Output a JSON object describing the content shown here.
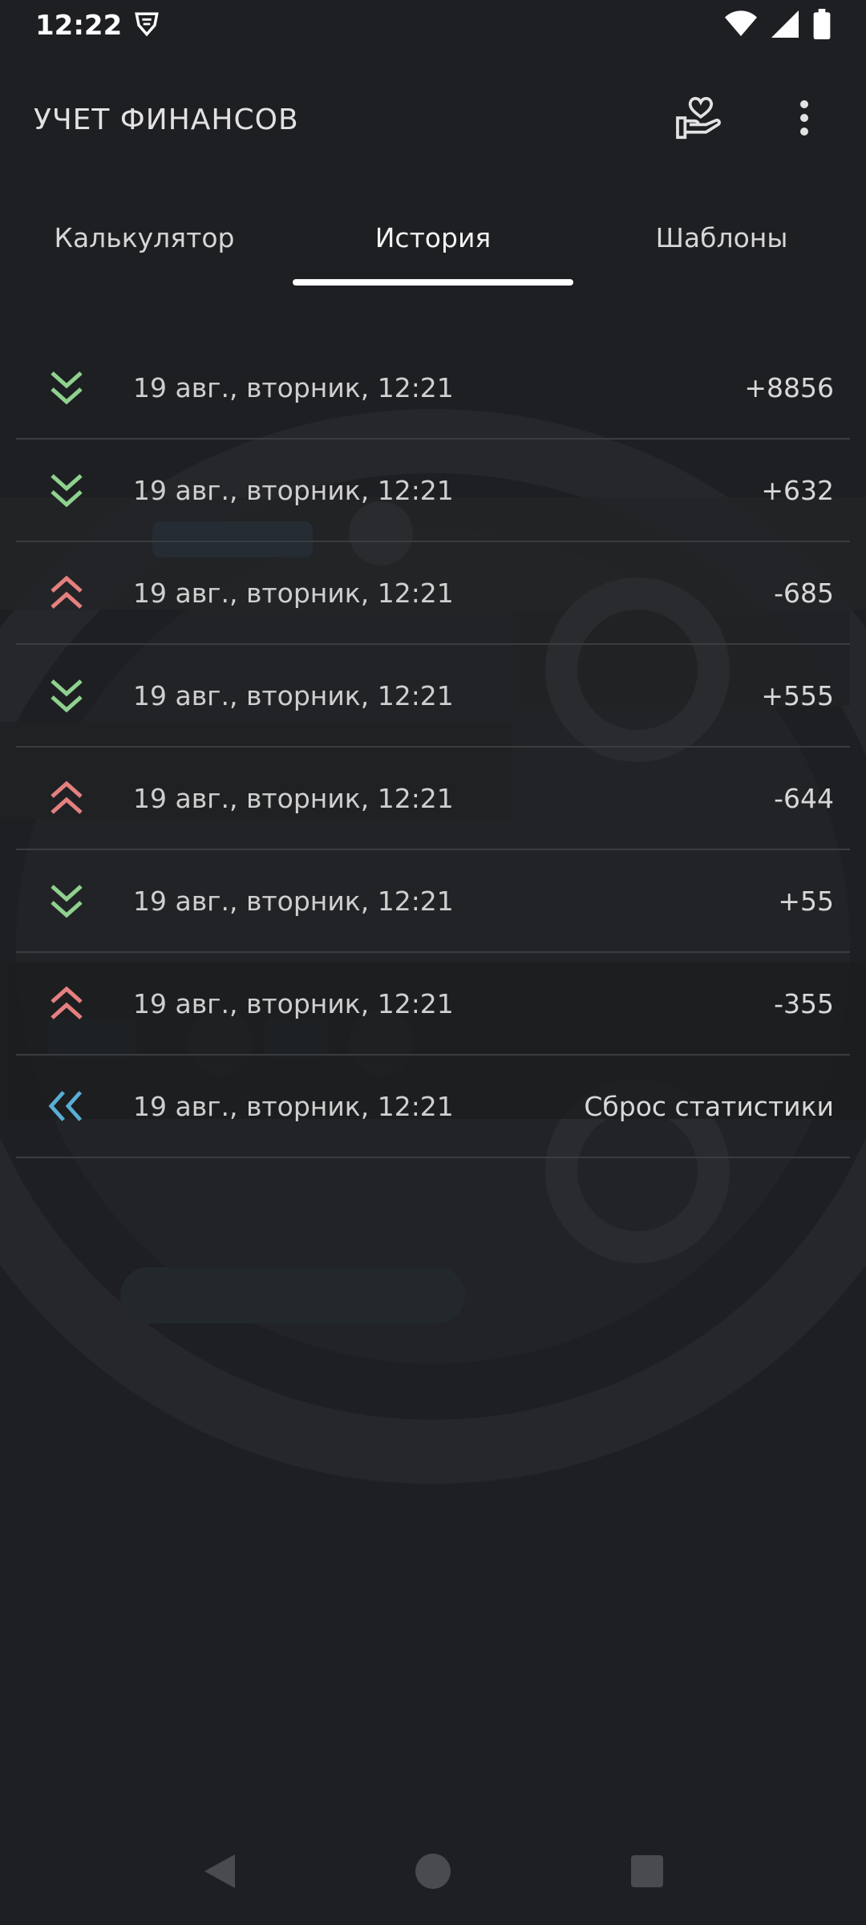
{
  "status_bar": {
    "time": "12:22",
    "icons": [
      "vpn-shield-icon",
      "wifi-icon",
      "signal-icon",
      "battery-icon"
    ]
  },
  "app_bar": {
    "title": "УЧЕТ ФИНАНСОВ",
    "actions": [
      "donate-hand-heart-icon",
      "more-vert-icon"
    ]
  },
  "tabs": [
    {
      "label": "Калькулятор",
      "active": false
    },
    {
      "label": "История",
      "active": true
    },
    {
      "label": "Шаблоны",
      "active": false
    }
  ],
  "history": [
    {
      "date": "19 авг., вторник, 12:21",
      "amount": "+8856",
      "type": "income"
    },
    {
      "date": "19 авг., вторник, 12:21",
      "amount": "+632",
      "type": "income"
    },
    {
      "date": "19 авг., вторник, 12:21",
      "amount": "-685",
      "type": "expense"
    },
    {
      "date": "19 авг., вторник, 12:21",
      "amount": "+555",
      "type": "income"
    },
    {
      "date": "19 авг., вторник, 12:21",
      "amount": "-644",
      "type": "expense"
    },
    {
      "date": "19 авг., вторник, 12:21",
      "amount": "+55",
      "type": "income"
    },
    {
      "date": "19 авг., вторник, 12:21",
      "amount": "-355",
      "type": "expense"
    },
    {
      "date": "19 авг., вторник, 12:21",
      "amount": "Сброс статистики",
      "type": "reset"
    }
  ],
  "colors": {
    "background": "#1e1f22",
    "income": "#8fd18f",
    "expense": "#e58080",
    "reset": "#5aaed6",
    "divider": "#3a3c40",
    "tab_indicator": "#ffffff"
  },
  "nav_bar": {
    "buttons": [
      "back-icon",
      "home-icon",
      "recents-icon"
    ]
  }
}
